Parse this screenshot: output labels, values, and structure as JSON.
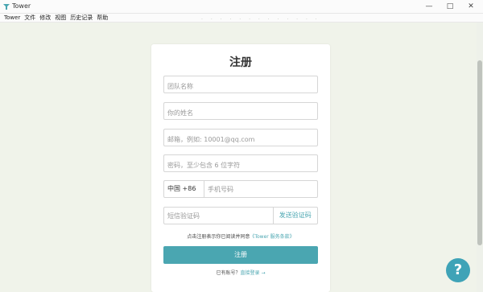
{
  "window": {
    "title": "Tower",
    "icon": "tower-logo-icon",
    "controls": {
      "minimize": "—",
      "maximize": "□",
      "close": "✕"
    }
  },
  "menu": [
    "Tower",
    "文件",
    "修改",
    "视图",
    "历史记录",
    "帮助"
  ],
  "form": {
    "heading": "注册",
    "team_name": {
      "placeholder": "团队名称",
      "value": ""
    },
    "your_name": {
      "placeholder": "你的姓名",
      "value": ""
    },
    "email": {
      "placeholder": "邮箱，例如: 10001@qq.com",
      "value": ""
    },
    "password": {
      "placeholder": "密码，至少包含 6 位字符",
      "value": ""
    },
    "country_code": "中国 +86",
    "phone": {
      "placeholder": "手机号码",
      "value": ""
    },
    "sms_code": {
      "placeholder": "短信验证码",
      "value": ""
    },
    "send_code_label": "发送验证码",
    "terms_text": "点击注册表示你已阅读并同意",
    "terms_link": "《Tower 服务条款》",
    "submit_label": "注册",
    "login_prompt": "已有账号？",
    "login_link": "直接登录 →"
  },
  "help_label": "?",
  "colors": {
    "accent": "#4aa6b1",
    "help_button": "#3fa3b7",
    "page_background": "#f0f3ea"
  }
}
